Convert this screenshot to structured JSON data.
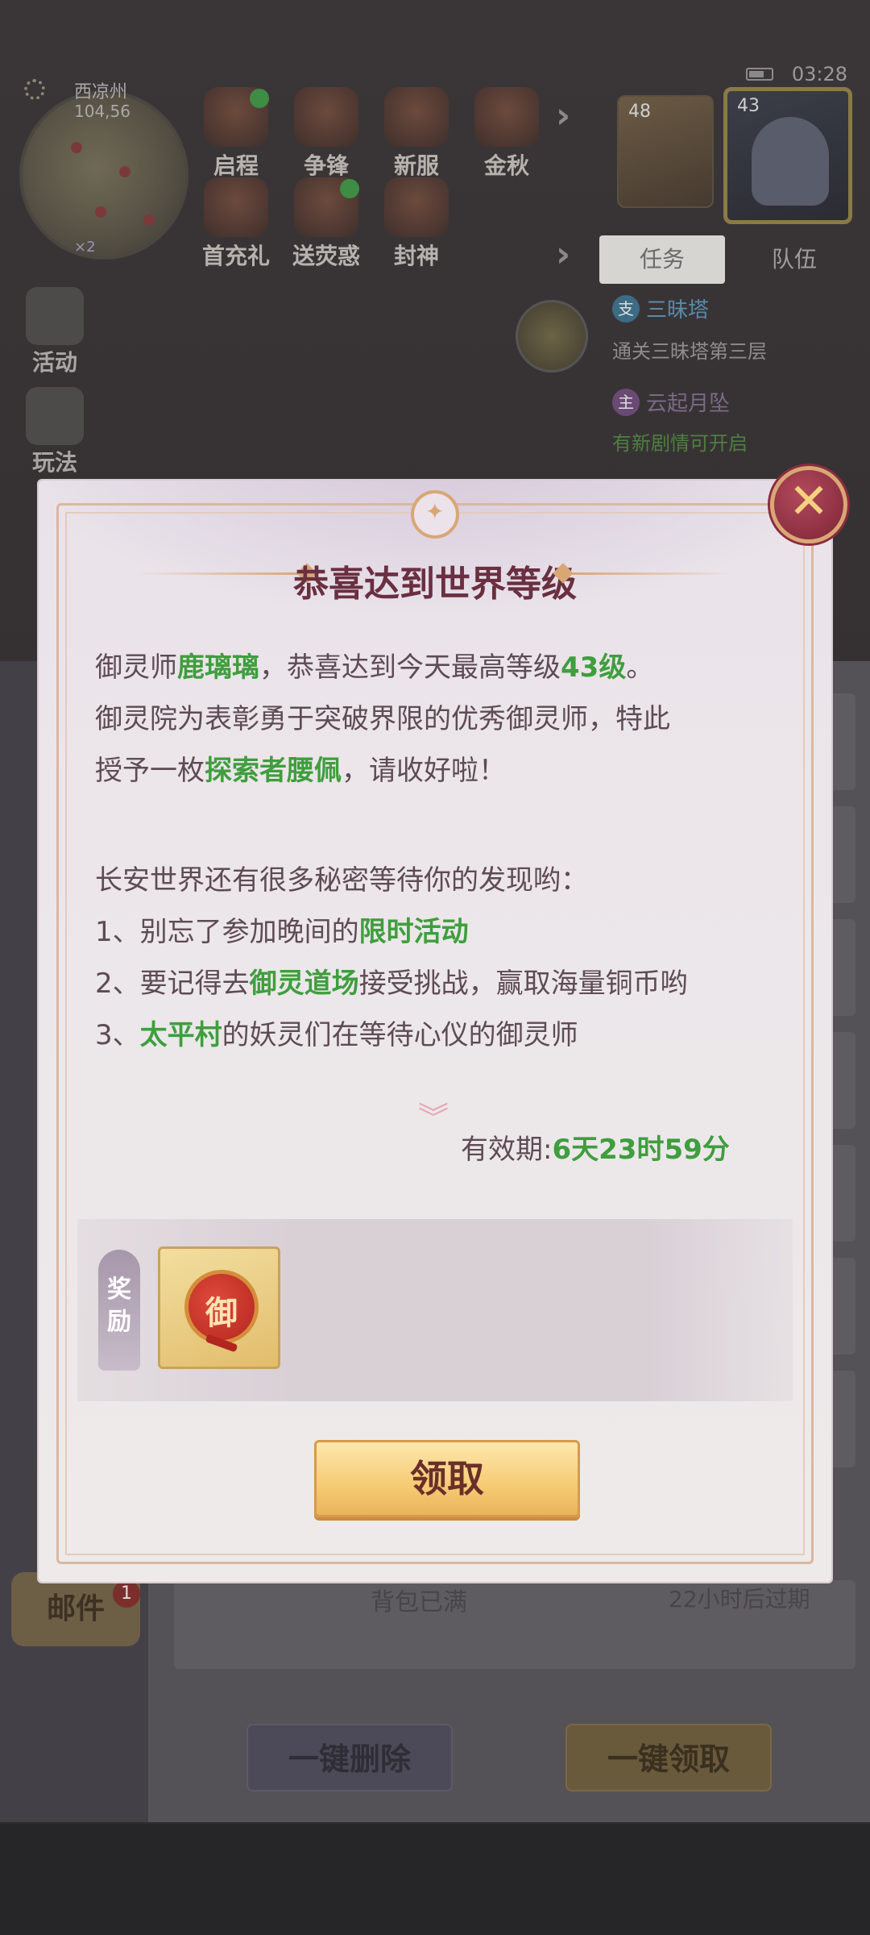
{
  "status_bar": {
    "time": "03:28"
  },
  "minimap": {
    "location": "西凉州",
    "coords": "104,56",
    "badge": "×2"
  },
  "top_icons": [
    {
      "label": "启程",
      "icon": "scroll-icon"
    },
    {
      "label": "争锋",
      "icon": "banner-icon"
    },
    {
      "label": "新服",
      "icon": "crown-icon"
    },
    {
      "label": "金秋",
      "icon": "rabbit-icon"
    },
    {
      "label": "首充礼",
      "icon": "gift-box-icon"
    },
    {
      "label": "送荧惑",
      "icon": "demon-icon"
    },
    {
      "label": "封神",
      "icon": "planet-icon"
    }
  ],
  "party": {
    "pet_level": "48",
    "hero_level": "43"
  },
  "task_tabs": {
    "active": "任务",
    "other": "队伍"
  },
  "tasks": [
    {
      "tag": "支",
      "name": "三昧塔",
      "desc": "通关三昧塔第三层"
    },
    {
      "tag": "主",
      "name": "云起月坠",
      "desc": "有新剧情可开启"
    }
  ],
  "side_buttons": [
    {
      "label": "活动"
    },
    {
      "label": "玩法"
    }
  ],
  "mail": {
    "tab_label": "邮件",
    "tab_badge": "1",
    "row_status": "背包已满",
    "row_expire": "22小时后过期",
    "delete_all": "一键删除",
    "claim_all": "一键领取"
  },
  "modal": {
    "title": "恭喜达到世界等级",
    "line1": {
      "a": "御灵师",
      "name": "鹿璃璃",
      "b": "，恭喜达到今天最高等级",
      "level": "43级",
      "c": "。"
    },
    "line2": "御灵院为表彰勇于突破界限的优秀御灵师，特此",
    "line3": {
      "a": "授予一枚",
      "item": "探索者腰佩",
      "b": "，请收好啦！"
    },
    "line4": "长安世界还有很多秘密等待你的发现哟：",
    "line5": {
      "a": "1、别忘了参加晚间的",
      "hl": "限时活动"
    },
    "line6": {
      "a": "2、要记得去",
      "hl": "御灵道场",
      "b": "接受挑战，赢取海量铜币哟"
    },
    "line7": {
      "a": "3、",
      "hl": "太平村",
      "b": "的妖灵们在等待心仪的御灵师"
    },
    "validity_label": "有效期:",
    "validity_value": "6天23时59分",
    "reward_label_top": "奖",
    "reward_label_bottom": "励",
    "reward_item_glyph": "御",
    "claim_button": "领取",
    "colors": {
      "title": "#6a2f40",
      "highlight": "#3f9e3d",
      "body": "#5e4b53",
      "accent_gold": "#d9a774"
    }
  }
}
